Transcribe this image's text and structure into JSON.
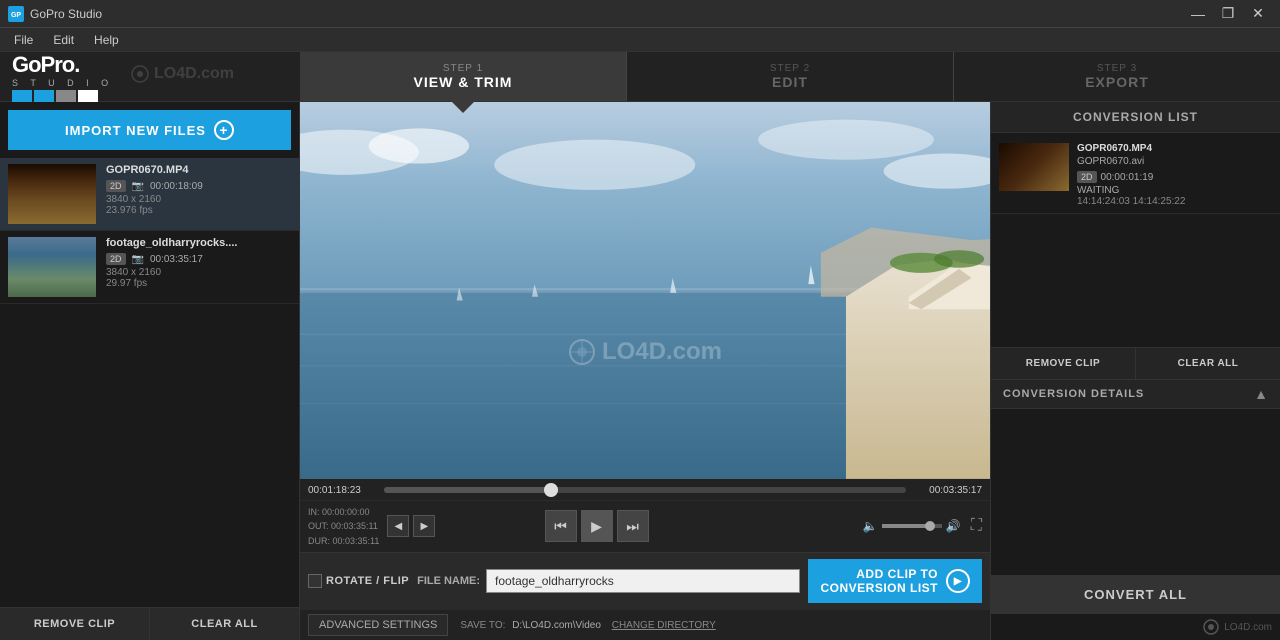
{
  "titlebar": {
    "title": "GoPro Studio",
    "icon": "gopro-icon",
    "min_btn": "—",
    "max_btn": "❐",
    "close_btn": "✕"
  },
  "menubar": {
    "items": [
      {
        "label": "File"
      },
      {
        "label": "Edit"
      },
      {
        "label": "Help"
      }
    ]
  },
  "logo": {
    "gopro_text": "GoPro.",
    "studio_text": "S T U D I O"
  },
  "steps": [
    {
      "id": "view-trim",
      "number": "STEP 1",
      "label": "VIEW & TRIM",
      "active": true
    },
    {
      "id": "edit",
      "number": "STEP 2",
      "label": "EDIT",
      "active": false
    },
    {
      "id": "export",
      "number": "STEP 3",
      "label": "EXPORT",
      "active": false
    }
  ],
  "left_panel": {
    "import_btn": "IMPORT NEW FILES",
    "files": [
      {
        "name": "GOPR0670.MP4",
        "badge": "2D",
        "duration": "00:00:18:09",
        "resolution": "3840 x 2160",
        "fps": "23.976 fps"
      },
      {
        "name": "footage_oldharryrocks....",
        "badge": "2D",
        "duration": "00:03:35:17",
        "resolution": "3840 x 2160",
        "fps": "29.97 fps"
      }
    ],
    "remove_clip_btn": "REMOVE CLIP",
    "clear_all_btn": "CLEAR ALL"
  },
  "video": {
    "time_current": "00:01:18:23",
    "time_end": "00:03:35:17",
    "in_point": "IN:  00:00:00:00",
    "out_point": "OUT: 00:03:35:11",
    "dur_point": "DUR: 00:03:35:11",
    "scrubber_pct": 32,
    "watermark": "LO4D.com"
  },
  "bottom_controls": {
    "rotate_flip_label": "ROTATE / FLIP",
    "filename_label": "FILE NAME:",
    "filename_value": "footage_oldharryrocks",
    "saveto_label": "SAVE TO:",
    "saveto_path": "D:\\LO4D.com\\Video",
    "change_dir_label": "CHANGE DIRECTORY",
    "add_clip_btn_line1": "ADD CLIP TO",
    "add_clip_btn_line2": "CONVERSION LIST",
    "advanced_settings_btn": "ADVANCED SETTINGS"
  },
  "right_panel": {
    "header": "CONVERSION LIST",
    "items": [
      {
        "name": "GOPR0670.MP4",
        "output": "GOPR0670.avi",
        "badge": "2D",
        "duration": "00:00:01:19",
        "status": "WAITING",
        "time_range": "14:14:24:03  14:14:25:22"
      }
    ],
    "remove_clip_btn": "REMOVE CLIP",
    "clear_btn": "CLEAR ALL",
    "details_header": "CONVERSION DETAILS",
    "convert_all_btn": "CONVERT ALL"
  },
  "colors": {
    "accent": "#1da0e0",
    "bg_dark": "#1a1a1a",
    "bg_mid": "#222",
    "text_main": "#ccc",
    "text_muted": "#888"
  }
}
